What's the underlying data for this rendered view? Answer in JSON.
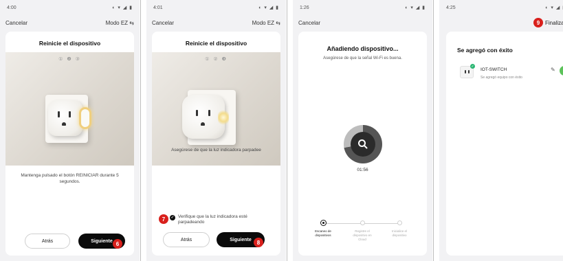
{
  "screens": [
    {
      "status_time": "4:00",
      "status_icons": "◐ ▾ ◢ ▮",
      "cancel": "Cancelar",
      "mode": "Modo EZ ⇆",
      "title": "Reinicie el dispositivo",
      "steps": "① ❷ ③",
      "instruction": "Mantenga pulsado el botón REINICIAR durante 5 segundos.",
      "back": "Atrás",
      "next": "Siguiente",
      "badge": "6"
    },
    {
      "status_time": "4:01",
      "status_icons": "◐ ▾ ◢ ▮",
      "cancel": "Cancelar",
      "mode": "Modo EZ ⇆",
      "title": "Reinicie el dispositivo",
      "steps": "① ② ❸",
      "instruction": "Asegúrese de que la luz indicadora parpadee",
      "checkbox_badge": "7",
      "checkbox_label": "Verifique que la luz indicadora esté parpadeando",
      "back": "Atrás",
      "next": "Siguiente",
      "badge": "8"
    },
    {
      "status_time": "1:26",
      "status_icons": "◐ ▾ ◢ ▮",
      "cancel": "Cancelar",
      "title": "Añadiendo dispositivo...",
      "subtitle": "Asegúrese de que la señal Wi-Fi es buena.",
      "timer": "01:56",
      "progress": 0.72,
      "steps": [
        {
          "label": "Escaneo de dispositivos",
          "active": true
        },
        {
          "label": "Registre el dispositivo en Cloud",
          "active": false
        },
        {
          "label": "Inicialice el dispositivo",
          "active": false
        }
      ]
    },
    {
      "status_time": "4:25",
      "status_icons": "◐ ▾ ◢ ▮",
      "badge": "9",
      "finish": "Finaliza",
      "success_title": "Se agregó con éxito",
      "device_name": "IOT-SWITCH",
      "device_sub": "Se agregó equipo con éxito"
    }
  ]
}
